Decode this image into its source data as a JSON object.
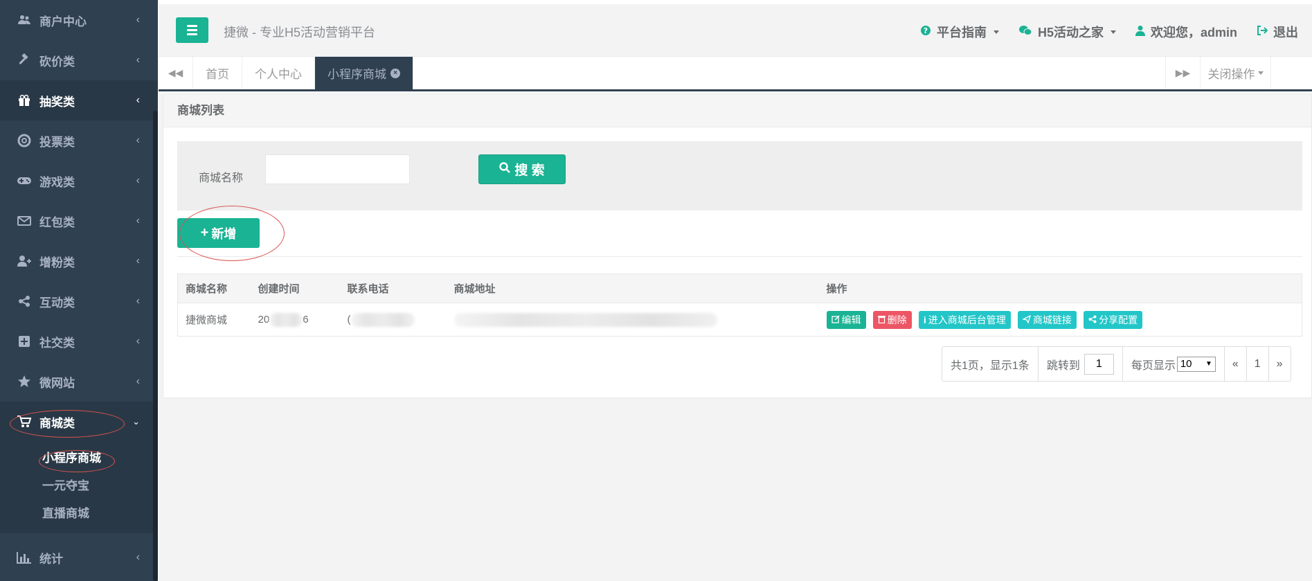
{
  "sidebar": {
    "items": [
      {
        "label": "商户中心",
        "icon": "users-icon"
      },
      {
        "label": "砍价类",
        "icon": "gavel-icon"
      },
      {
        "label": "抽奖类",
        "icon": "gift-icon"
      },
      {
        "label": "投票类",
        "icon": "lifering-icon"
      },
      {
        "label": "游戏类",
        "icon": "gamepad-icon"
      },
      {
        "label": "红包类",
        "icon": "envelope-icon"
      },
      {
        "label": "增粉类",
        "icon": "user-plus-icon"
      },
      {
        "label": "互动类",
        "icon": "share-icon"
      },
      {
        "label": "社交类",
        "icon": "plus-square-icon"
      },
      {
        "label": "微网站",
        "icon": "star-icon"
      },
      {
        "label": "商城类",
        "icon": "cart-icon"
      }
    ],
    "submenu": [
      "小程序商城",
      "一元夺宝",
      "直播商城"
    ],
    "bottom": {
      "label": "统计",
      "icon": "bar-chart-icon"
    }
  },
  "topbar": {
    "brand": "捷微 - 专业H5活动营销平台",
    "guide": "平台指南",
    "home": "H5活动之家",
    "welcome": "欢迎您，admin",
    "logout": "退出"
  },
  "tabs": {
    "items": [
      "首页",
      "个人中心",
      "小程序商城"
    ],
    "close_ops": "关闭操作"
  },
  "panel": {
    "title": "商城列表",
    "search_label": "商城名称",
    "search_value": "",
    "search_button": "搜 索",
    "add_button": "新增"
  },
  "table": {
    "headers": [
      "商城名称",
      "创建时间",
      "联系电话",
      "商城地址",
      "操作"
    ],
    "rows": [
      {
        "name": "捷微商城",
        "created_prefix": "20",
        "created_suffix": "6",
        "phone_prefix": "("
      }
    ],
    "actions": [
      "编辑",
      "删除",
      "进入商城后台管理",
      "商城链接",
      "分享配置"
    ]
  },
  "pager": {
    "summary": "共1页，显示1条",
    "jump_label": "跳转到",
    "jump_value": "1",
    "per_page_label": "每页显示",
    "per_page_value": "10",
    "prev": "«",
    "page": "1",
    "next": "»"
  },
  "colors": {
    "sidebar_bg": "#2f4050",
    "accent": "#1ab394",
    "danger": "#ed5565",
    "info": "#23c6c8"
  }
}
